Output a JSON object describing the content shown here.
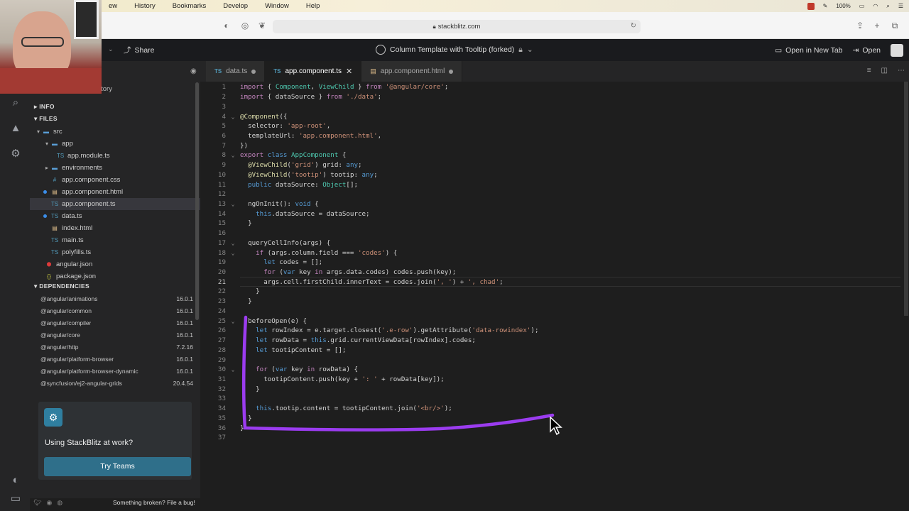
{
  "menubar": {
    "menus": [
      "ew",
      "History",
      "Bookmarks",
      "Develop",
      "Window",
      "Help"
    ],
    "battery": "100%"
  },
  "browser": {
    "url": "stackblitz.com"
  },
  "header": {
    "share_label": "Share",
    "project_title": "Column Template with Tooltip (forked)",
    "open_new_tab_label": "Open in New Tab",
    "open_label": "Open"
  },
  "sidebar": {
    "overlay_text": "itory",
    "info_label": "INFO",
    "files_label": "FILES",
    "files": [
      {
        "name": "src",
        "kind": "folder",
        "modified": false
      },
      {
        "name": "app",
        "kind": "folder",
        "modified": false
      },
      {
        "name": "app.module.ts",
        "kind": "ts",
        "modified": false
      },
      {
        "name": "environments",
        "kind": "folder",
        "modified": false
      },
      {
        "name": "app.component.css",
        "kind": "css",
        "modified": false
      },
      {
        "name": "app.component.html",
        "kind": "html",
        "modified": true
      },
      {
        "name": "app.component.ts",
        "kind": "ts",
        "modified": false
      },
      {
        "name": "data.ts",
        "kind": "ts",
        "modified": true
      },
      {
        "name": "index.html",
        "kind": "html",
        "modified": false
      },
      {
        "name": "main.ts",
        "kind": "ts",
        "modified": false
      },
      {
        "name": "polyfills.ts",
        "kind": "ts",
        "modified": false
      },
      {
        "name": "angular.json",
        "kind": "json",
        "modified": false
      },
      {
        "name": "package.json",
        "kind": "json",
        "modified": false
      }
    ],
    "dependencies_label": "DEPENDENCIES",
    "dependencies": [
      {
        "name": "@angular/animations",
        "version": "16.0.1"
      },
      {
        "name": "@angular/common",
        "version": "16.0.1"
      },
      {
        "name": "@angular/compiler",
        "version": "16.0.1"
      },
      {
        "name": "@angular/core",
        "version": "16.0.1"
      },
      {
        "name": "@angular/http",
        "version": "7.2.16"
      },
      {
        "name": "@angular/platform-browser",
        "version": "16.0.1"
      },
      {
        "name": "@angular/platform-browser-dynamic",
        "version": "16.0.1"
      },
      {
        "name": "@syncfusion/ej2-angular-grids",
        "version": "20.4.54"
      }
    ],
    "teams_text": "Using StackBlitz at work?",
    "teams_button": "Try Teams",
    "broken_text": "Something broken? File a bug!"
  },
  "tabs": [
    {
      "label": "data.ts",
      "modified": true,
      "active": false,
      "icon": "TS"
    },
    {
      "label": "app.component.ts",
      "modified": false,
      "active": true,
      "icon": "TS"
    },
    {
      "label": "app.component.html",
      "modified": true,
      "active": false,
      "icon": "html-icon"
    }
  ],
  "editor": {
    "current_line": 21,
    "lines": [
      "import { Component, ViewChild } from '@angular/core';",
      "import { dataSource } from './data';",
      "",
      "@Component({",
      "  selector: 'app-root',",
      "  templateUrl: 'app.component.html',",
      "})",
      "export class AppComponent {",
      "  @ViewChild('grid') grid: any;",
      "  @ViewChild('tootip') tootip: any;",
      "  public dataSource: Object[];",
      "",
      "  ngOnInit(): void {",
      "    this.dataSource = dataSource;",
      "  }",
      "",
      "  queryCellInfo(args) {",
      "    if (args.column.field === 'codes') {",
      "      let codes = [];",
      "      for (var key in args.data.codes) codes.push(key);",
      "      args.cell.firstChild.innerText = codes.join(', ') + ', chad';",
      "    }",
      "  }",
      "",
      "  beforeOpen(e) {",
      "    let rowIndex = e.target.closest('.e-row').getAttribute('data-rowindex');",
      "    let rowData = this.grid.currentViewData[rowIndex].codes;",
      "    let tootipContent = [];",
      "",
      "    for (var key in rowData) {",
      "      tootipContent.push(key + ': ' + rowData[key]);",
      "    }",
      "",
      "    this.tootip.content = tootipContent.join('<br/>');",
      "  }",
      "}",
      ""
    ],
    "folds": [
      4,
      8,
      13,
      17,
      18,
      25,
      30
    ]
  },
  "colors": {
    "annotation": "#9b3cf0",
    "accent": "#3b8eea"
  }
}
